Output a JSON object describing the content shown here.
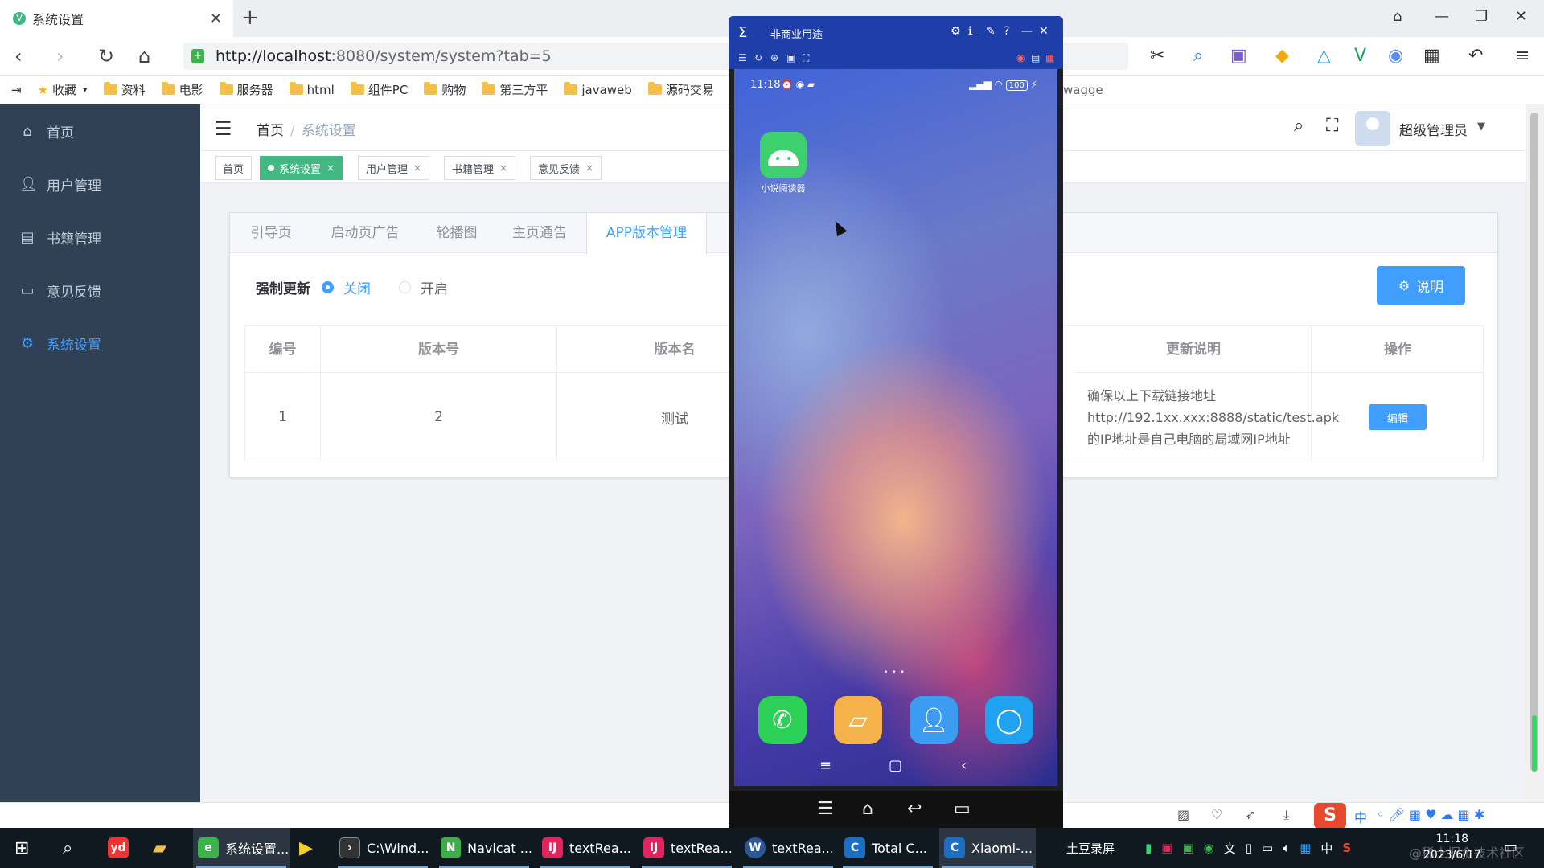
{
  "browser": {
    "tab_title": "系统设置",
    "tab_favicon": "V",
    "address_host": "http://localhost",
    "address_rest": ":8080/system/system?tab=5",
    "bookmarks": [
      "收藏",
      "资料",
      "电影",
      "服务器",
      "html",
      "组件PC",
      "购物",
      "第三方平",
      "javaweb",
      "源码交易"
    ],
    "bookmark_tail": "wagge"
  },
  "sidebar": {
    "items": [
      {
        "label": "首页",
        "icon": "home-icon"
      },
      {
        "label": "用户管理",
        "icon": "user-icon"
      },
      {
        "label": "书籍管理",
        "icon": "book-icon"
      },
      {
        "label": "意见反馈",
        "icon": "message-icon"
      },
      {
        "label": "系统设置",
        "icon": "settings-icon",
        "active": true
      }
    ]
  },
  "header": {
    "breadcrumb_home": "首页",
    "breadcrumb_sep": "/",
    "breadcrumb_current": "系统设置",
    "user_name": "超级管理员"
  },
  "tags": [
    {
      "label": "首页"
    },
    {
      "label": "系统设置",
      "active": true
    },
    {
      "label": "用户管理"
    },
    {
      "label": "书籍管理"
    },
    {
      "label": "意见反馈"
    }
  ],
  "tag_close": "×",
  "settings": {
    "tabs": [
      "引导页",
      "启动页广告",
      "轮播图",
      "主页通告",
      "APP版本管理"
    ],
    "active_tab": "APP版本管理",
    "force_update_label": "强制更新",
    "radio_off": "关闭",
    "radio_on": "开启",
    "selected_radio": "关闭",
    "explain_button": "说明",
    "table": {
      "headers": [
        "编号",
        "版本号",
        "版本名",
        "更新说明",
        "操作"
      ],
      "rows": [
        {
          "id": "1",
          "version_code": "2",
          "version_name": "测试",
          "note": "确保以上下载链接地址http://192.1xx.xxx:8888/static/test.apk的IP地址是自己电脑的局域网IP地址",
          "action": "编辑"
        }
      ]
    }
  },
  "phone": {
    "window_title": "非商业用途",
    "status_time": "11:18",
    "status_battery": "100",
    "app_label": "小说阅读器"
  },
  "taskbar": {
    "apps": [
      {
        "label": "系统设置...",
        "icon": "browser-icon",
        "color": "#3bb34a"
      },
      {
        "label": "C:\\Wind...",
        "icon": "terminal-icon",
        "color": "#333333"
      },
      {
        "label": "Navicat ...",
        "icon": "navicat-icon",
        "color": "#3fae49"
      },
      {
        "label": "textRea...",
        "icon": "intellij-icon",
        "color": "#e0245e"
      },
      {
        "label": "textRea...",
        "icon": "intellij-icon",
        "color": "#e0245e"
      },
      {
        "label": "textRea...",
        "icon": "word-icon",
        "color": "#2b5797"
      },
      {
        "label": "Total C...",
        "icon": "total-commander-icon",
        "color": "#1b6ec2"
      },
      {
        "label": "Xiaomi-...",
        "icon": "emulator-icon",
        "color": "#1b6ec2"
      }
    ],
    "recorder_label": "土豆录屏",
    "ime_label": "中",
    "clock_time": "11:18",
    "clock_date": "2023/6/17",
    "watermark": "@稀土掘金技术社区"
  },
  "colors": {
    "sidebar_bg": "#304156",
    "accent": "#409eff",
    "tag_active": "#42b983"
  }
}
